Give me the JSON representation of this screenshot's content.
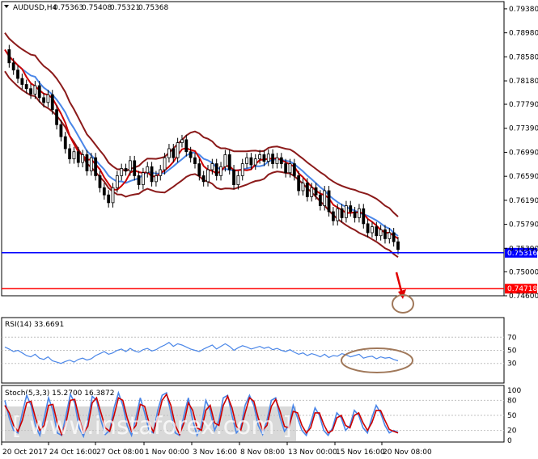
{
  "chart_data": [
    {
      "type": "candlestick",
      "title": "AUDUSD,H4",
      "ohlc_values": [
        "0.75363",
        "0.75408",
        "0.75321",
        "0.75368"
      ],
      "ylim": [
        0.746,
        0.795
      ],
      "yticks": [
        "0.79380",
        "0.78980",
        "0.78580",
        "0.78180",
        "0.77790",
        "0.77390",
        "0.76990",
        "0.76590",
        "0.76190",
        "0.75790",
        "0.75390",
        "0.75000",
        "0.74600"
      ],
      "xticks": [
        "20 Oct 2017",
        "24 Oct 16:00",
        "27 Oct 08:00",
        "1 Nov 00:00",
        "3 Nov 16:00",
        "8 Nov 08:00",
        "13 Nov 00:00",
        "15 Nov 16:00",
        "20 Nov 08:00"
      ],
      "close_path": [
        0.787,
        0.7848,
        0.7836,
        0.7822,
        0.7812,
        0.7805,
        0.7796,
        0.781,
        0.779,
        0.7782,
        0.7795,
        0.777,
        0.7745,
        0.7725,
        0.7705,
        0.7688,
        0.77,
        0.7682,
        0.7695,
        0.7668,
        0.769,
        0.766,
        0.764,
        0.7628,
        0.7615,
        0.764,
        0.766,
        0.7672,
        0.7668,
        0.7685,
        0.766,
        0.7645,
        0.7665,
        0.7675,
        0.765,
        0.766,
        0.767,
        0.769,
        0.7705,
        0.769,
        0.7715,
        0.772,
        0.77,
        0.769,
        0.768,
        0.766,
        0.765,
        0.767,
        0.768,
        0.766,
        0.7675,
        0.7695,
        0.767,
        0.7645,
        0.766,
        0.768,
        0.769,
        0.7678,
        0.7688,
        0.7695,
        0.7684,
        0.7696,
        0.768,
        0.769,
        0.768,
        0.7665,
        0.768,
        0.766,
        0.7635,
        0.7648,
        0.7625,
        0.764,
        0.7628,
        0.761,
        0.7635,
        0.76,
        0.7585,
        0.7605,
        0.759,
        0.761,
        0.76,
        0.759,
        0.7605,
        0.758,
        0.7565,
        0.7575,
        0.756,
        0.757,
        0.7555,
        0.7565,
        0.755,
        0.7537
      ],
      "price_lines": [
        {
          "value": "0.75316",
          "color": "#0000ff"
        },
        {
          "value": "0.74718",
          "color": "#ff0000"
        }
      ],
      "indicators": [
        "Bollinger Bands",
        "Moving Average"
      ],
      "annotations": [
        "down arrow to target",
        "target circle"
      ]
    },
    {
      "type": "line",
      "title": "RSI(14) 33.6691",
      "ylim": [
        0,
        100
      ],
      "yticks": [
        "70",
        "50",
        "30"
      ],
      "series": [
        {
          "color": "#4a86e8",
          "values": [
            55,
            52,
            48,
            50,
            46,
            42,
            40,
            44,
            38,
            36,
            40,
            34,
            32,
            30,
            33,
            35,
            32,
            36,
            38,
            35,
            37,
            42,
            45,
            48,
            44,
            46,
            50,
            52,
            48,
            53,
            49,
            47,
            51,
            53,
            49,
            51,
            55,
            58,
            62,
            56,
            60,
            58,
            55,
            52,
            50,
            48,
            52,
            55,
            58,
            52,
            56,
            60,
            56,
            50,
            54,
            57,
            55,
            52,
            54,
            56,
            53,
            55,
            51,
            53,
            50,
            48,
            51,
            47,
            44,
            46,
            42,
            45,
            43,
            40,
            44,
            39,
            42,
            41,
            45,
            43,
            40,
            42,
            44,
            38,
            40,
            41,
            37,
            40,
            38,
            39,
            36,
            34
          ]
        }
      ],
      "annotations": [
        "oval highlight"
      ]
    },
    {
      "type": "line",
      "title": "Stoch(5,3,3) 15.2700 16.3872",
      "ylim": [
        0,
        100
      ],
      "yticks": [
        "100",
        "80",
        "50",
        "20",
        "0"
      ],
      "series": [
        {
          "color": "#4a86e8",
          "values": [
            80,
            45,
            20,
            15,
            55,
            90,
            70,
            30,
            10,
            45,
            85,
            60,
            15,
            10,
            50,
            92,
            75,
            25,
            8,
            40,
            88,
            80,
            40,
            12,
            20,
            65,
            95,
            70,
            30,
            10,
            45,
            85,
            55,
            20,
            15,
            60,
            90,
            95,
            55,
            15,
            10,
            50,
            85,
            40,
            10,
            30,
            80,
            60,
            20,
            40,
            85,
            90,
            50,
            15,
            25,
            70,
            90,
            70,
            30,
            12,
            40,
            80,
            85,
            45,
            18,
            30,
            70,
            45,
            20,
            10,
            35,
            65,
            50,
            20,
            10,
            25,
            55,
            45,
            20,
            30,
            60,
            50,
            25,
            15,
            45,
            70,
            55,
            30,
            15,
            20,
            16
          ]
        },
        {
          "color": "#cc0000",
          "values": [
            70,
            55,
            30,
            18,
            40,
            75,
            78,
            45,
            20,
            30,
            70,
            72,
            35,
            12,
            35,
            80,
            82,
            45,
            15,
            28,
            75,
            85,
            55,
            25,
            18,
            50,
            85,
            80,
            45,
            18,
            30,
            72,
            68,
            35,
            17,
            45,
            80,
            92,
            70,
            30,
            12,
            35,
            75,
            60,
            25,
            20,
            60,
            70,
            35,
            30,
            70,
            88,
            65,
            28,
            20,
            55,
            85,
            78,
            45,
            20,
            30,
            68,
            82,
            58,
            28,
            25,
            58,
            55,
            30,
            15,
            25,
            55,
            55,
            32,
            15,
            20,
            45,
            50,
            30,
            25,
            50,
            55,
            35,
            20,
            35,
            60,
            60,
            40,
            22,
            18,
            15
          ]
        }
      ]
    }
  ],
  "watermark": "[ www.instaforex.com ]"
}
